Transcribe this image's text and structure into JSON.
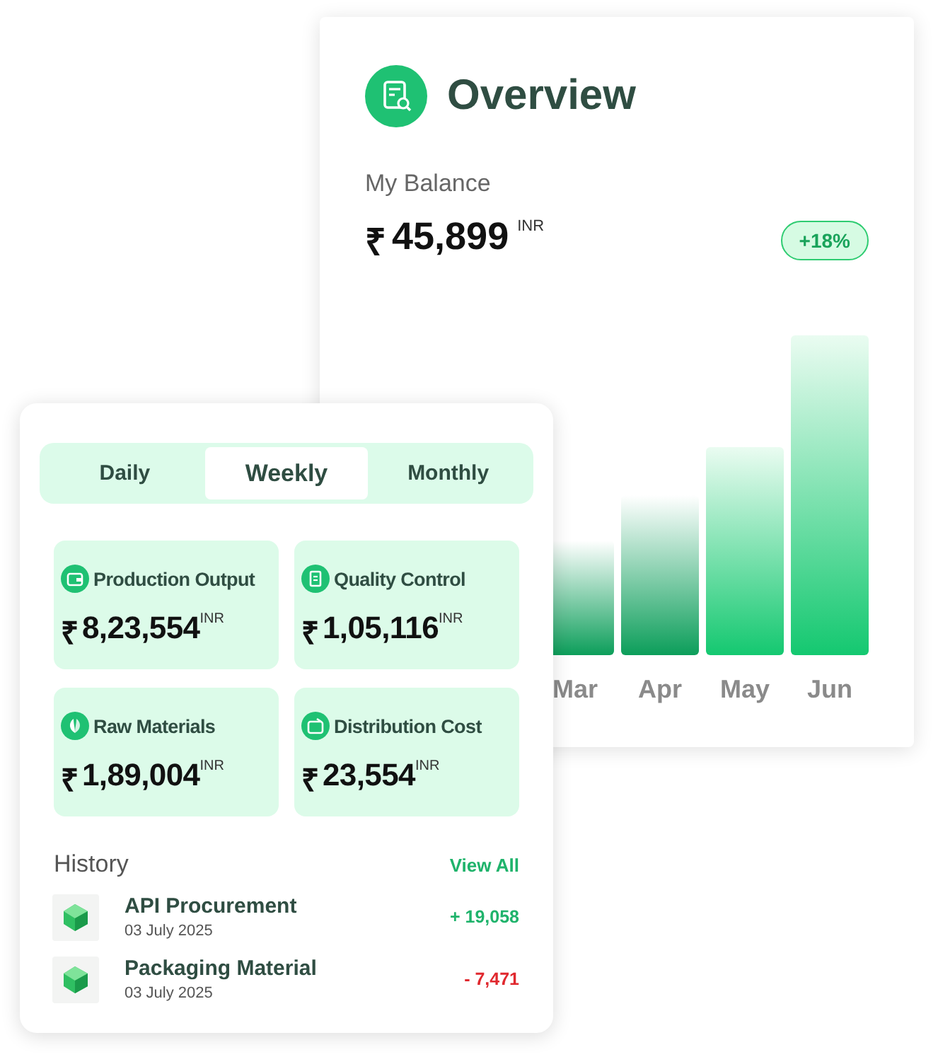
{
  "overview": {
    "title": "Overview",
    "balance_label": "My Balance",
    "currency_symbol": "₹",
    "balance": "45,899",
    "unit": "INR",
    "change": "+18%",
    "months": [
      "Mar",
      "Apr",
      "May",
      "Jun"
    ]
  },
  "summary": {
    "tabs": [
      {
        "label": "Daily",
        "selected": false
      },
      {
        "label": "Weekly",
        "selected": true
      },
      {
        "label": "Monthly",
        "selected": false
      }
    ],
    "stats": [
      {
        "label": "Production Output",
        "symbol": "₹",
        "amount": "8,23,554",
        "unit": "INR"
      },
      {
        "label": "Quality Control",
        "symbol": "₹",
        "amount": "1,05,116",
        "unit": "INR"
      },
      {
        "label": "Raw Materials",
        "symbol": "₹",
        "amount": "1,89,004",
        "unit": "INR"
      },
      {
        "label": "Distribution Cost",
        "symbol": "₹",
        "amount": "23,554",
        "unit": "INR"
      }
    ],
    "history_title": "History",
    "view_all": "View All",
    "history": [
      {
        "title": "API Procurement",
        "date": "03 July 2025",
        "amount": "+ 19,058",
        "kind": "credit"
      },
      {
        "title": "Packaging Material",
        "date": "03 July 2025",
        "amount": "- 7,471",
        "kind": "debit"
      }
    ]
  }
}
